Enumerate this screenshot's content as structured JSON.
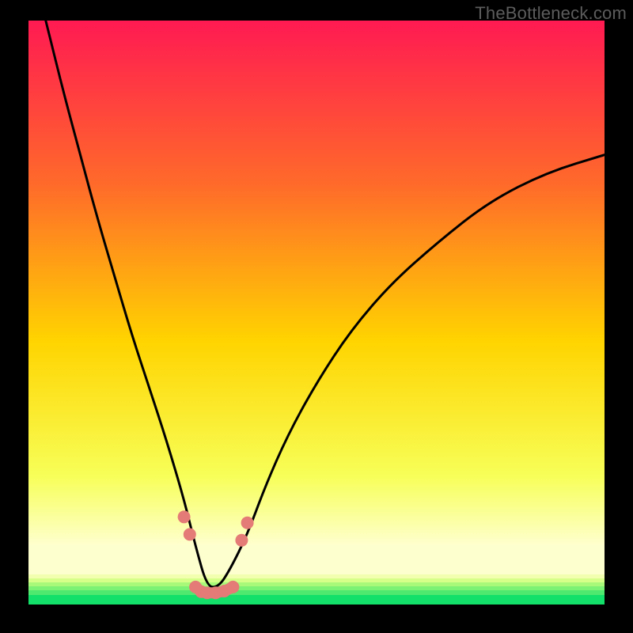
{
  "watermark": "TheBottleneck.com",
  "colors": {
    "gradient_top": "#ff1a52",
    "gradient_mid_upper": "#ff6a2a",
    "gradient_mid": "#ffd400",
    "gradient_lower": "#f7ff58",
    "gradient_pale": "#feffcf",
    "gradient_bottom": "#12e06a",
    "curve": "#000000",
    "marker_fill": "#e47b76",
    "frame_bg": "#000000"
  },
  "chart_data": {
    "type": "line",
    "title": "",
    "xlabel": "",
    "ylabel": "",
    "xlim": [
      0,
      100
    ],
    "ylim": [
      0,
      100
    ],
    "grid": false,
    "note": "Axes unlabeled in source; values estimated from pixel positions on a 0–100 normalized scale. Curve is a V-shaped profile with minimum near x≈31.",
    "series": [
      {
        "name": "bottleneck-curve",
        "x": [
          3,
          6,
          9,
          12,
          15,
          18,
          21,
          24,
          27,
          29,
          31,
          33,
          35,
          38,
          41,
          45,
          50,
          56,
          63,
          71,
          80,
          90,
          100
        ],
        "y": [
          100,
          88,
          77,
          66,
          56,
          46,
          37,
          28,
          18,
          10,
          3,
          3,
          6,
          12,
          20,
          29,
          38,
          47,
          55,
          62,
          69,
          74,
          77
        ]
      }
    ],
    "markers": [
      {
        "name": "left-marker-1",
        "x": 27,
        "y": 15
      },
      {
        "name": "left-marker-2",
        "x": 28,
        "y": 12
      },
      {
        "name": "floor-marker-1",
        "x": 29,
        "y": 3
      },
      {
        "name": "floor-marker-2",
        "x": 30,
        "y": 2.2
      },
      {
        "name": "floor-marker-3",
        "x": 31,
        "y": 2
      },
      {
        "name": "floor-marker-4",
        "x": 32.5,
        "y": 2
      },
      {
        "name": "floor-marker-5",
        "x": 34,
        "y": 2.3
      },
      {
        "name": "floor-marker-6",
        "x": 35.5,
        "y": 3
      },
      {
        "name": "right-marker-1",
        "x": 37,
        "y": 11
      },
      {
        "name": "right-marker-2",
        "x": 38,
        "y": 14
      }
    ]
  }
}
